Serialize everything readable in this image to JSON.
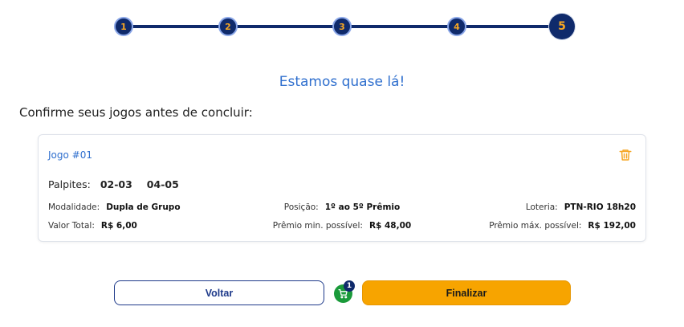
{
  "stepper": {
    "steps": [
      "1",
      "2",
      "3",
      "4",
      "5"
    ],
    "active_step": "5"
  },
  "headline": "Estamos quase lá!",
  "subhead": "Confirme seus jogos antes de concluir:",
  "game": {
    "title": "Jogo #01",
    "palpites_label": "Palpites:",
    "palpites": [
      "02-03",
      "04-05"
    ],
    "modalidade_label": "Modalidade:",
    "modalidade_value": "Dupla de Grupo",
    "posicao_label": "Posição:",
    "posicao_value": "1º ao 5º Prêmio",
    "loteria_label": "Loteria:",
    "loteria_value": "PTN-RIO 18h20",
    "valor_label": "Valor Total:",
    "valor_value": "R$ 6,00",
    "premio_min_label": "Prêmio min. possível:",
    "premio_min_value": "R$ 48,00",
    "premio_max_label": "Prêmio máx. possível:",
    "premio_max_value": "R$ 192,00",
    "delete_icon": "trash-icon"
  },
  "actions": {
    "back_label": "Voltar",
    "finish_label": "Finalizar",
    "cart_count": "1",
    "cart_icon": "cart-icon"
  },
  "colors": {
    "primary_navy": "#0f2a6b",
    "accent_orange": "#f7a400",
    "link_blue": "#2f6fce",
    "cart_green": "#1a9a3a"
  }
}
